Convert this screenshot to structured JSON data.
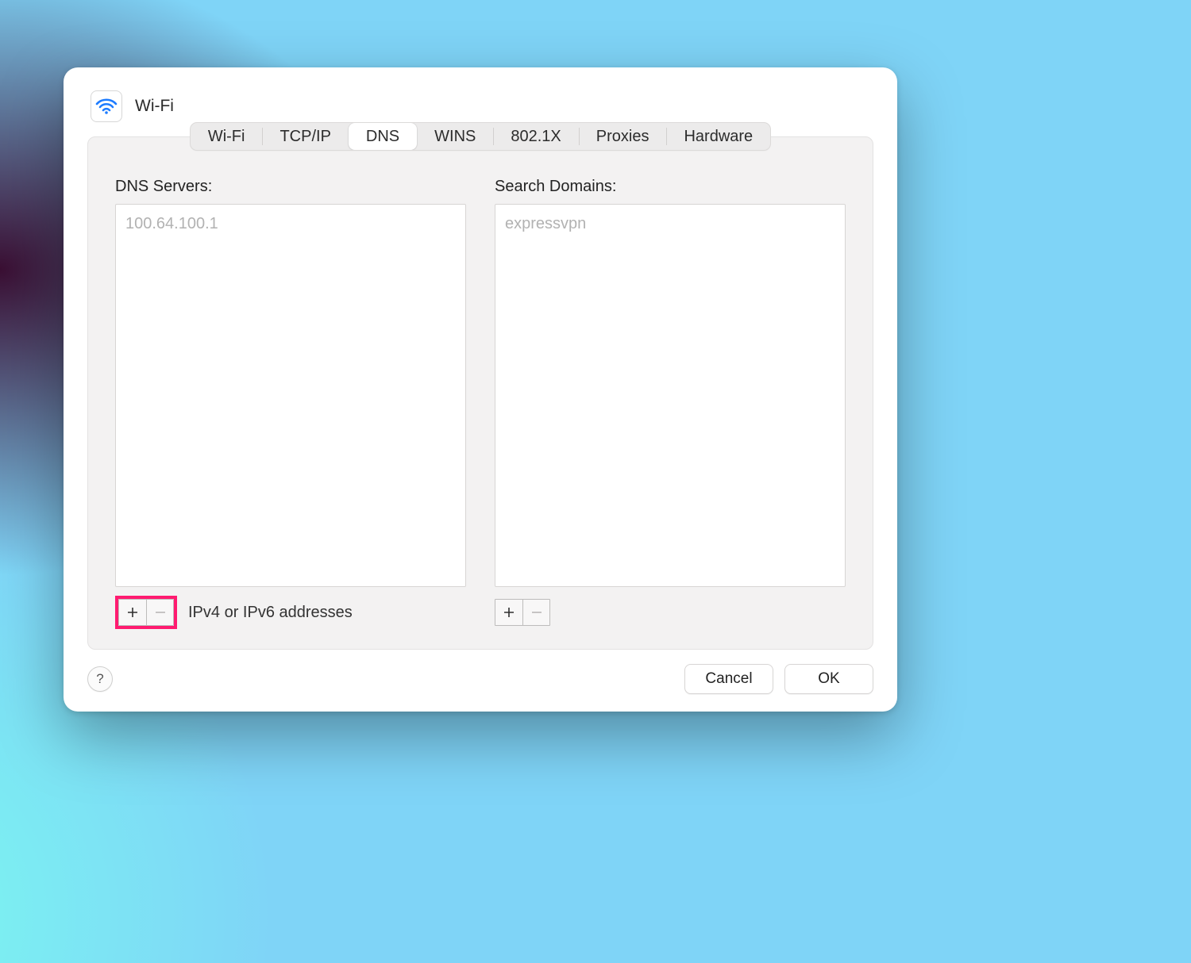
{
  "header": {
    "title": "Wi-Fi",
    "icon": "wifi-icon"
  },
  "tabs": [
    {
      "id": "wifi",
      "label": "Wi-Fi",
      "active": false
    },
    {
      "id": "tcpip",
      "label": "TCP/IP",
      "active": false
    },
    {
      "id": "dns",
      "label": "DNS",
      "active": true
    },
    {
      "id": "wins",
      "label": "WINS",
      "active": false
    },
    {
      "id": "8021x",
      "label": "802.1X",
      "active": false
    },
    {
      "id": "proxies",
      "label": "Proxies",
      "active": false
    },
    {
      "id": "hardware",
      "label": "Hardware",
      "active": false
    }
  ],
  "dns": {
    "servers_label": "DNS Servers:",
    "servers": [
      "100.64.100.1"
    ],
    "hint": "IPv4 or IPv6 addresses",
    "add_highlighted": true
  },
  "search_domains": {
    "label": "Search Domains:",
    "items": [
      "expressvpn"
    ]
  },
  "footer": {
    "help": "?",
    "cancel": "Cancel",
    "ok": "OK"
  }
}
